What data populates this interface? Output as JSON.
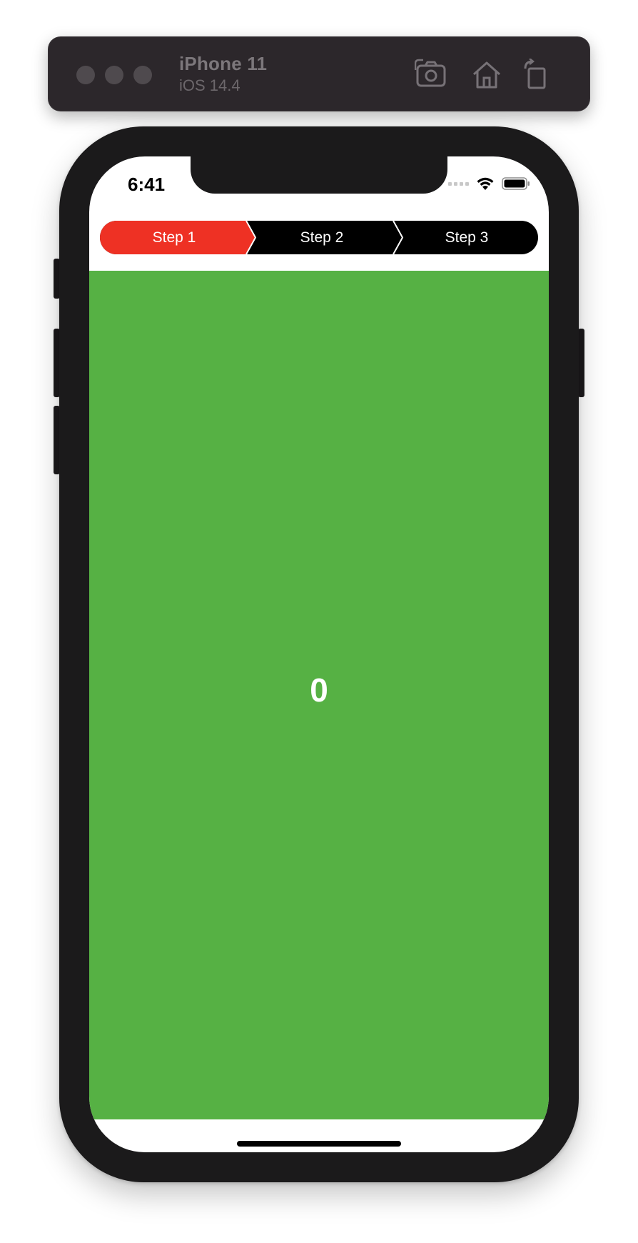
{
  "simulator": {
    "device_name": "iPhone 11",
    "os_version": "iOS 14.4",
    "icons": [
      "screenshot-icon",
      "home-icon",
      "rotate-icon"
    ]
  },
  "status_bar": {
    "time": "6:41",
    "icons": [
      "signal-icon",
      "wifi-icon",
      "battery-icon"
    ]
  },
  "stepper": {
    "steps": [
      {
        "label": "Step 1",
        "active": true
      },
      {
        "label": "Step 2",
        "active": false
      },
      {
        "label": "Step 3",
        "active": false
      }
    ],
    "active_color": "#EE3124",
    "inactive_color": "#000000"
  },
  "content": {
    "counter": "0",
    "background_color": "#56B144"
  }
}
